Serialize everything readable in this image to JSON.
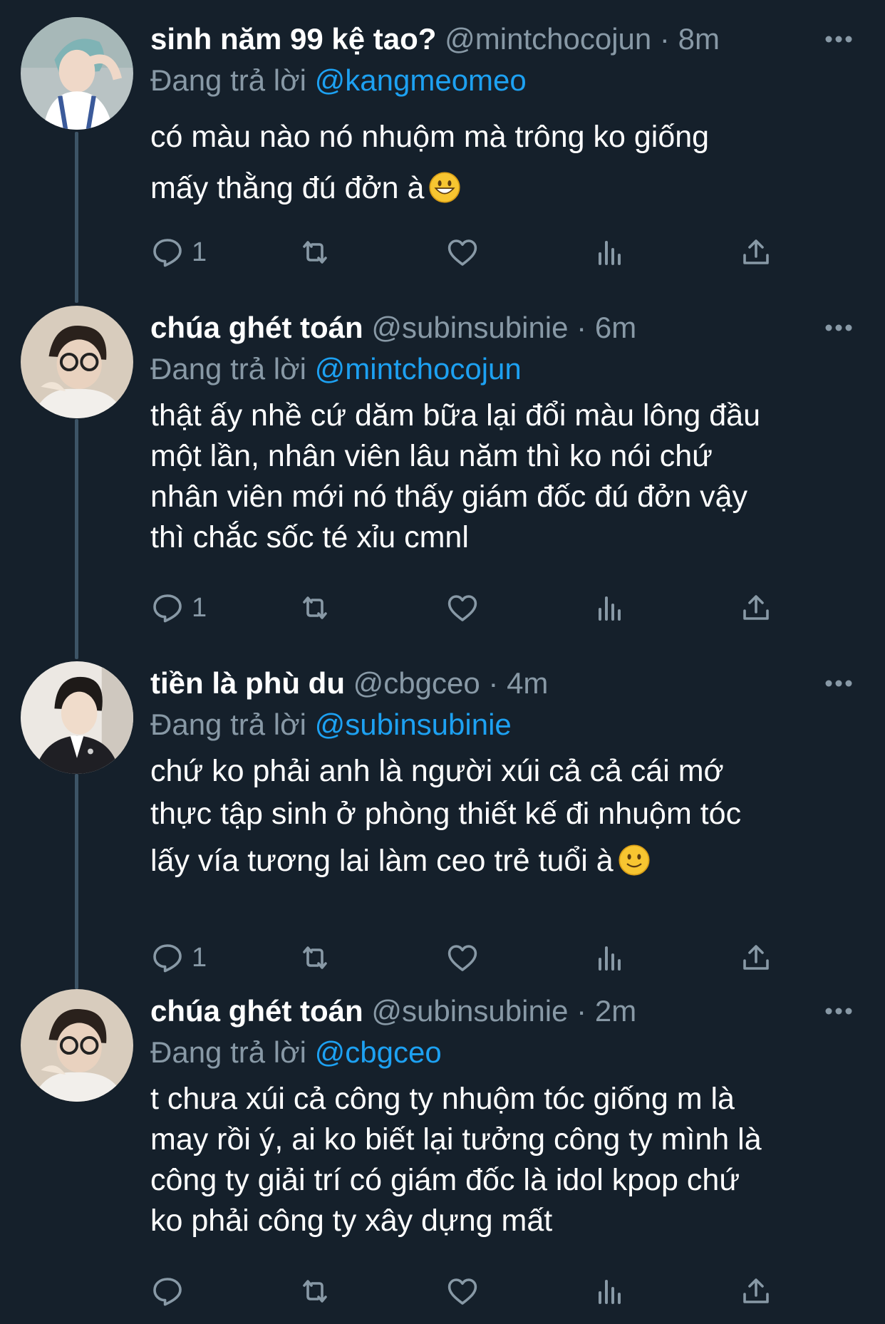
{
  "tweets": [
    {
      "name": "sinh năm 99 kệ tao?",
      "handle": "@mintchocojun",
      "dot": "·",
      "time": "8m",
      "reply_prefix": "Đang trả lời",
      "reply_to": "@kangmeomeo",
      "lines": [
        "có màu nào nó nhuộm mà trông ko giống",
        "mấy thằng đú đởn à"
      ],
      "emoji": "grinning-face",
      "reply_count": "1"
    },
    {
      "name": "chúa ghét toán",
      "handle": "@subinsubinie",
      "dot": "·",
      "time": "6m",
      "reply_prefix": "Đang trả lời",
      "reply_to": "@mintchocojun",
      "lines": [
        "thật ấy nhề cứ dăm bữa lại đổi màu lông đầu",
        "một lần, nhân viên lâu năm thì ko nói chứ",
        "nhân viên mới nó thấy giám đốc đú đởn vậy",
        "thì chắc sốc té xỉu cmnl"
      ],
      "reply_count": "1"
    },
    {
      "name": "tiền là phù du",
      "handle": "@cbgceo",
      "dot": "·",
      "time": "4m",
      "reply_prefix": "Đang trả lời",
      "reply_to": "@subinsubinie",
      "lines": [
        "chứ ko phải anh là người xúi cả cả cái mớ",
        "thực tập sinh ở phòng thiết kế đi nhuộm tóc",
        "lấy vía tương lai làm ceo trẻ tuổi à"
      ],
      "emoji": "slightly-smiling-face",
      "reply_count": "1"
    },
    {
      "name": "chúa ghét toán",
      "handle": "@subinsubinie",
      "dot": "·",
      "time": "2m",
      "reply_prefix": "Đang trả lời",
      "reply_to": "@cbgceo",
      "lines": [
        "t chưa xúi cả công ty nhuộm tóc giống m là",
        "may rồi ý, ai ko biết lại tưởng công ty mình là",
        "công ty giải trí có giám đốc là idol kpop chứ",
        "ko phải công ty xây dựng mất"
      ],
      "reply_count": ""
    }
  ],
  "icons": {
    "reply": "reply-icon",
    "retweet": "retweet-icon",
    "like": "heart-icon",
    "analytics": "analytics-icon",
    "share": "share-icon",
    "more": "more-icon"
  },
  "colors": {
    "background": "#15202b",
    "muted": "#8899a6",
    "link": "#1da1f2",
    "thread_line": "#3d5466"
  }
}
